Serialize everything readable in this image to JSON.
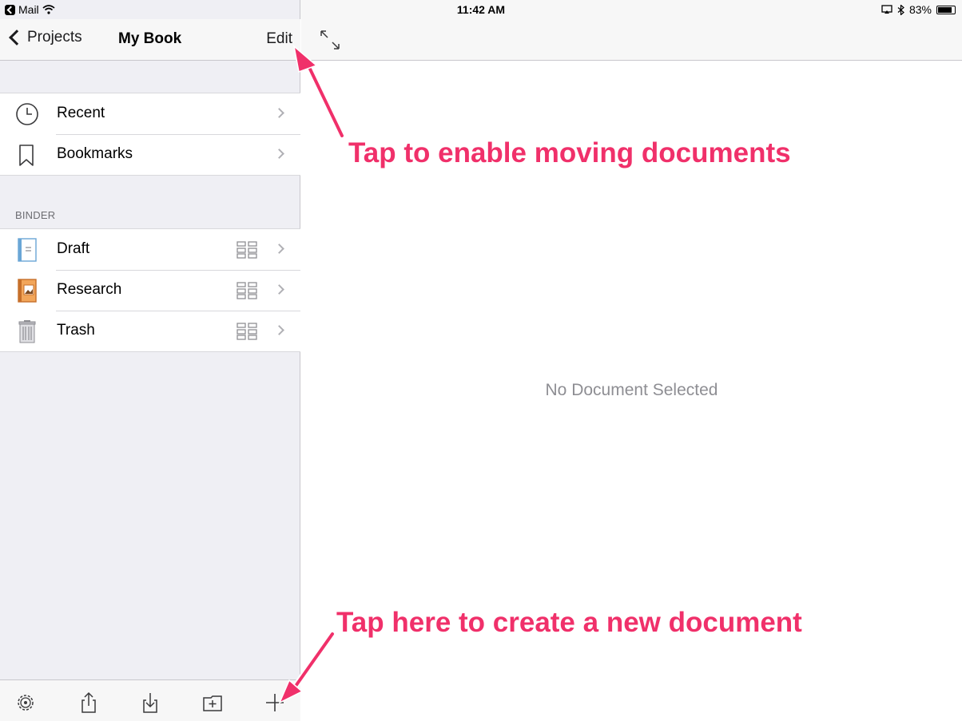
{
  "status_bar": {
    "back_app": "Mail",
    "time": "11:42 AM",
    "battery_text": "83%",
    "battery_level": 0.83
  },
  "sidebar": {
    "back_label": "Projects",
    "title": "My Book",
    "edit_label": "Edit",
    "top_items": [
      {
        "label": "Recent",
        "icon": "clock-icon"
      },
      {
        "label": "Bookmarks",
        "icon": "bookmark-icon"
      }
    ],
    "binder_header": "BINDER",
    "binder_items": [
      {
        "label": "Draft",
        "icon": "draft-folder-icon"
      },
      {
        "label": "Research",
        "icon": "research-folder-icon"
      },
      {
        "label": "Trash",
        "icon": "trash-icon"
      }
    ],
    "toolbar": [
      "settings-gear-icon",
      "share-icon",
      "import-icon",
      "new-folder-icon",
      "add-document-icon"
    ]
  },
  "detail": {
    "empty_message": "No Document Selected"
  },
  "annotations": {
    "edit_hint": "Tap to enable moving documents",
    "add_hint": "Tap here to create a new document"
  },
  "colors": {
    "annotation": "#f0306a",
    "sidebar_bg": "#efeff4",
    "bar_bg": "#f7f7f7"
  }
}
